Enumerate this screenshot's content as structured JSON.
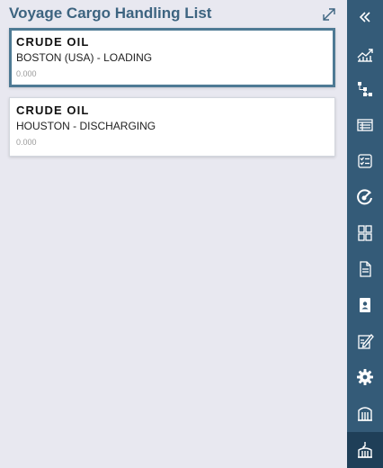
{
  "panel": {
    "title": "Voyage Cargo Handling List"
  },
  "cards": [
    {
      "cargo": "CRUDE OIL",
      "location": "BOSTON (USA) - LOADING",
      "quantity": "0.000",
      "selected": true
    },
    {
      "cargo": "CRUDE OIL",
      "location": "HOUSTON - DISCHARGING",
      "quantity": "0.000",
      "selected": false
    }
  ],
  "sidebar": {
    "items": [
      {
        "icon": "collapse-chevrons-icon"
      },
      {
        "icon": "line-chart-icon"
      },
      {
        "icon": "hierarchy-icon"
      },
      {
        "icon": "schedule-table-icon"
      },
      {
        "icon": "checklist-icon"
      },
      {
        "icon": "speedometer-icon"
      },
      {
        "icon": "grid-layout-icon"
      },
      {
        "icon": "document-icon"
      },
      {
        "icon": "contact-card-icon"
      },
      {
        "icon": "edit-form-icon"
      },
      {
        "icon": "gear-icon"
      },
      {
        "icon": "tank-icon"
      },
      {
        "icon": "cargo-handling-icon",
        "active": true
      }
    ]
  },
  "colors": {
    "accent": "#345b78",
    "selected_border": "#4e7a94",
    "title": "#3d6480"
  }
}
